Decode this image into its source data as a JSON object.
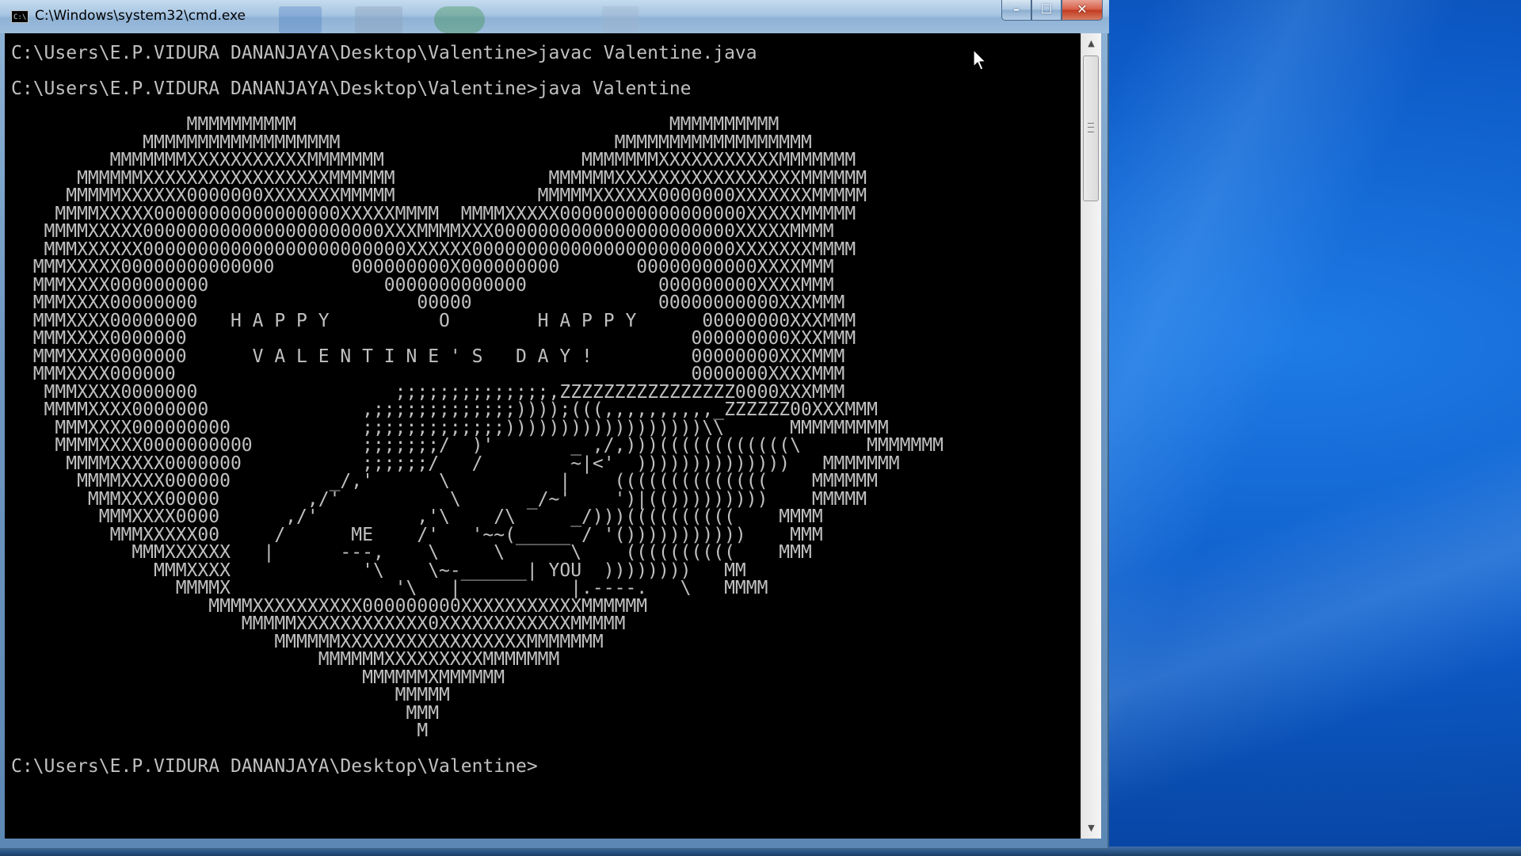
{
  "window": {
    "title": "C:\\Windows\\system32\\cmd.exe",
    "icon_label": "C:\\",
    "minimize_label": "–",
    "maximize_label": "☐",
    "close_label": "✕"
  },
  "console": {
    "text": "C:\\Users\\E.P.VIDURA DANANJAYA\\Desktop\\Valentine>javac Valentine.java\n\nC:\\Users\\E.P.VIDURA DANANJAYA\\Desktop\\Valentine>java Valentine\n\n                MMMMMMMMMM                                  MMMMMMMMMM\n            MMMMMMMMMMMMMMMMMM                         MMMMMMMMMMMMMMMMMM\n         MMMMMMMXXXXXXXXXXXMMMMMMM                  MMMMMMMXXXXXXXXXXXMMMMMMM\n      MMMMMMXXXXXXXXXXXXXXXXXMMMMMM              MMMMMMXXXXXXXXXXXXXXXXXMMMMMM\n     MMMMMXXXXXX0000000XXXXXXXMMMMM             MMMMMXXXXXX0000000XXXXXXXMMMMM\n    MMMMXXXXX00000000000000000XXXXXMMMM  MMMMXXXXX00000000000000000XXXXXMMMMM\n   MMMMXXXXX0000000000000000000000XXXMMMMXXX0000000000000000000000XXXXXMMMM\n   MMMXXXXXX000000000000000000000000XXXXXX000000000000000000000000XXXXXXXMMMM\n  MMMXXXXX00000000000000       000000000X000000000       00000000000XXXXMMM\n  MMMXXXX000000000                0000000000000            000000000XXXXMMM\n  MMMXXXX00000000                    00000                 00000000000XXXMMM\n  MMMXXXX00000000   H A P P Y          O        H A P P Y      00000000XXXMMM\n  MMMXXXX0000000                                              000000000XXXMMM\n  MMMXXXX0000000      V A L E N T I N E ' S   D A Y !         00000000XXXMMM\n  MMMXXXX000000                                               0000000XXXXMMM\n   MMMXXXX0000000                  ;;;;;;;;;;;;;;,ZZZZZZZZZZZZZZZZ0000XXXMMM\n   MMMMXXXX0000000              ,;;;;;;;;;;;;;))));(((,,,,,,,,,,_ZZZZZZ00XXXMMM\n    MMMXXXX000000000            ;;;;;;;;;;;;;))))))))))))))))))\\\\      MMMMMMMMM\n    MMMMXXXX0000000000          ;;;;;;;/  )'       _ ,/,)))((((((((((((\\      MMMMMMM\n     MMMMXXXXX0000000           ;;;;;;/   /        ~|<'  ))))))))))))))   MMMMMMM\n      MMMMXXXX000000         _/,'      \\          |    ((((((((((((((    MMMMMM\n       MMMXXXX00000        ,/'          \\      _/~'    ')|(()))))))))    MMMMM\n        MMMXXXX0000      ,/'         ,'\\    /\\     _/)))((((((((((    MMMM\n         MMMXXXXX00     /      ME    /'   '~~(_____ / '()))))))))))    MMM\n           MMMXXXXXX   |      ---,    \\     \\      \\    ((((((((((    MMM\n             MMMXXXX            '\\    \\~-______| YOU  ))))))))   MM\n               MMMMX               '\\   |          |.----.   \\   MMMM\n                  MMMMXXXXXXXXXX000000000XXXXXXXXXXXMMMMMM\n                     MMMMMXXXXXXXXXXXX0XXXXXXXXXXXXMMMMM\n                        MMMMMMXXXXXXXXXXXXXXXXXMMMMMMM\n                            MMMMMMXXXXXXXXXMMMMMMM\n                                MMMMMMXMMMMMM\n                                   MMMMM\n                                    MMM\n                                     M\n\nC:\\Users\\E.P.VIDURA DANANJAYA\\Desktop\\Valentine>"
  },
  "icons": {
    "cursor": "mouse-pointer-icon",
    "scroll_up": "scroll-up-arrow-icon",
    "scroll_down": "scroll-down-arrow-icon"
  },
  "colors": {
    "console_bg": "#000000",
    "console_text": "#c0c0c0",
    "desktop_blue": "#0d5bc8",
    "close_red": "#c03a20"
  }
}
